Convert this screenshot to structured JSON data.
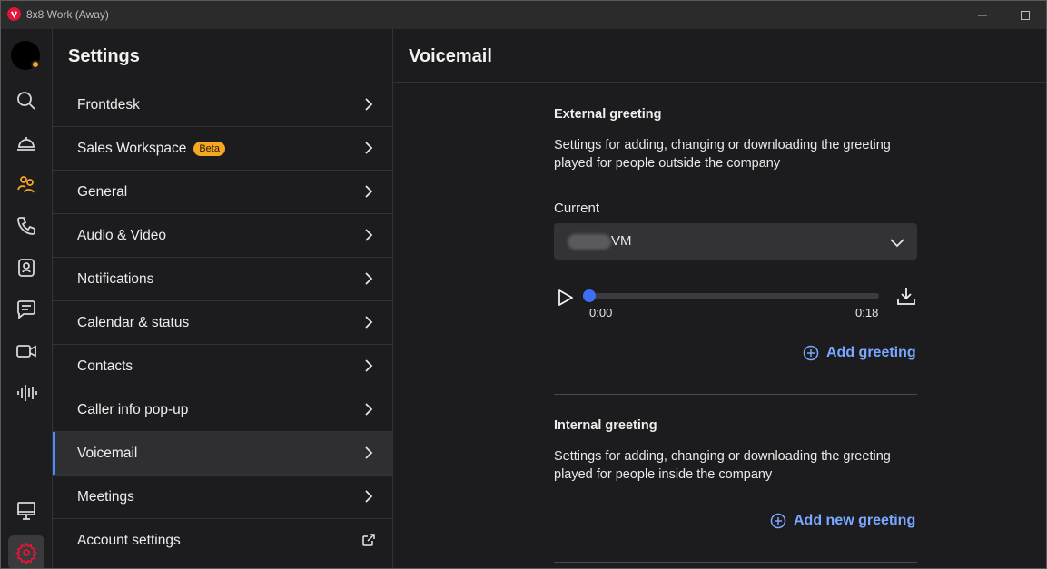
{
  "window": {
    "title": "8x8 Work (Away)"
  },
  "settings": {
    "title": "Settings",
    "items": [
      {
        "label": "Frontdesk"
      },
      {
        "label": "Sales Workspace",
        "badge": "Beta"
      },
      {
        "label": "General"
      },
      {
        "label": "Audio & Video"
      },
      {
        "label": "Notifications"
      },
      {
        "label": "Calendar & status"
      },
      {
        "label": "Contacts"
      },
      {
        "label": "Caller info pop-up"
      },
      {
        "label": "Voicemail"
      },
      {
        "label": "Meetings"
      },
      {
        "label": "Account settings"
      }
    ],
    "selected": "Voicemail"
  },
  "voicemail": {
    "title": "Voicemail",
    "external": {
      "title": "External greeting",
      "description": "Settings for adding, changing or downloading the greeting played for people outside the company",
      "current_label": "Current",
      "selected_greeting": "VM",
      "time_start": "0:00",
      "time_end": "0:18",
      "progress": 0,
      "add_label": "Add greeting"
    },
    "internal": {
      "title": "Internal greeting",
      "description": "Settings for adding, changing or downloading the greeting played for people inside the company",
      "add_label": "Add new greeting"
    }
  },
  "colors": {
    "accent": "#7aa7ff",
    "brand": "#e0163a",
    "status_away": "#f5a623",
    "active_rail": "#e0163a"
  },
  "rail_icons": [
    "search-icon",
    "frontdesk-bell-icon",
    "contacts-group-icon",
    "phone-icon",
    "contact-card-icon",
    "chat-icon",
    "video-icon",
    "voicemail-waveform-icon",
    "monitor-icon",
    "settings-gear-icon"
  ]
}
